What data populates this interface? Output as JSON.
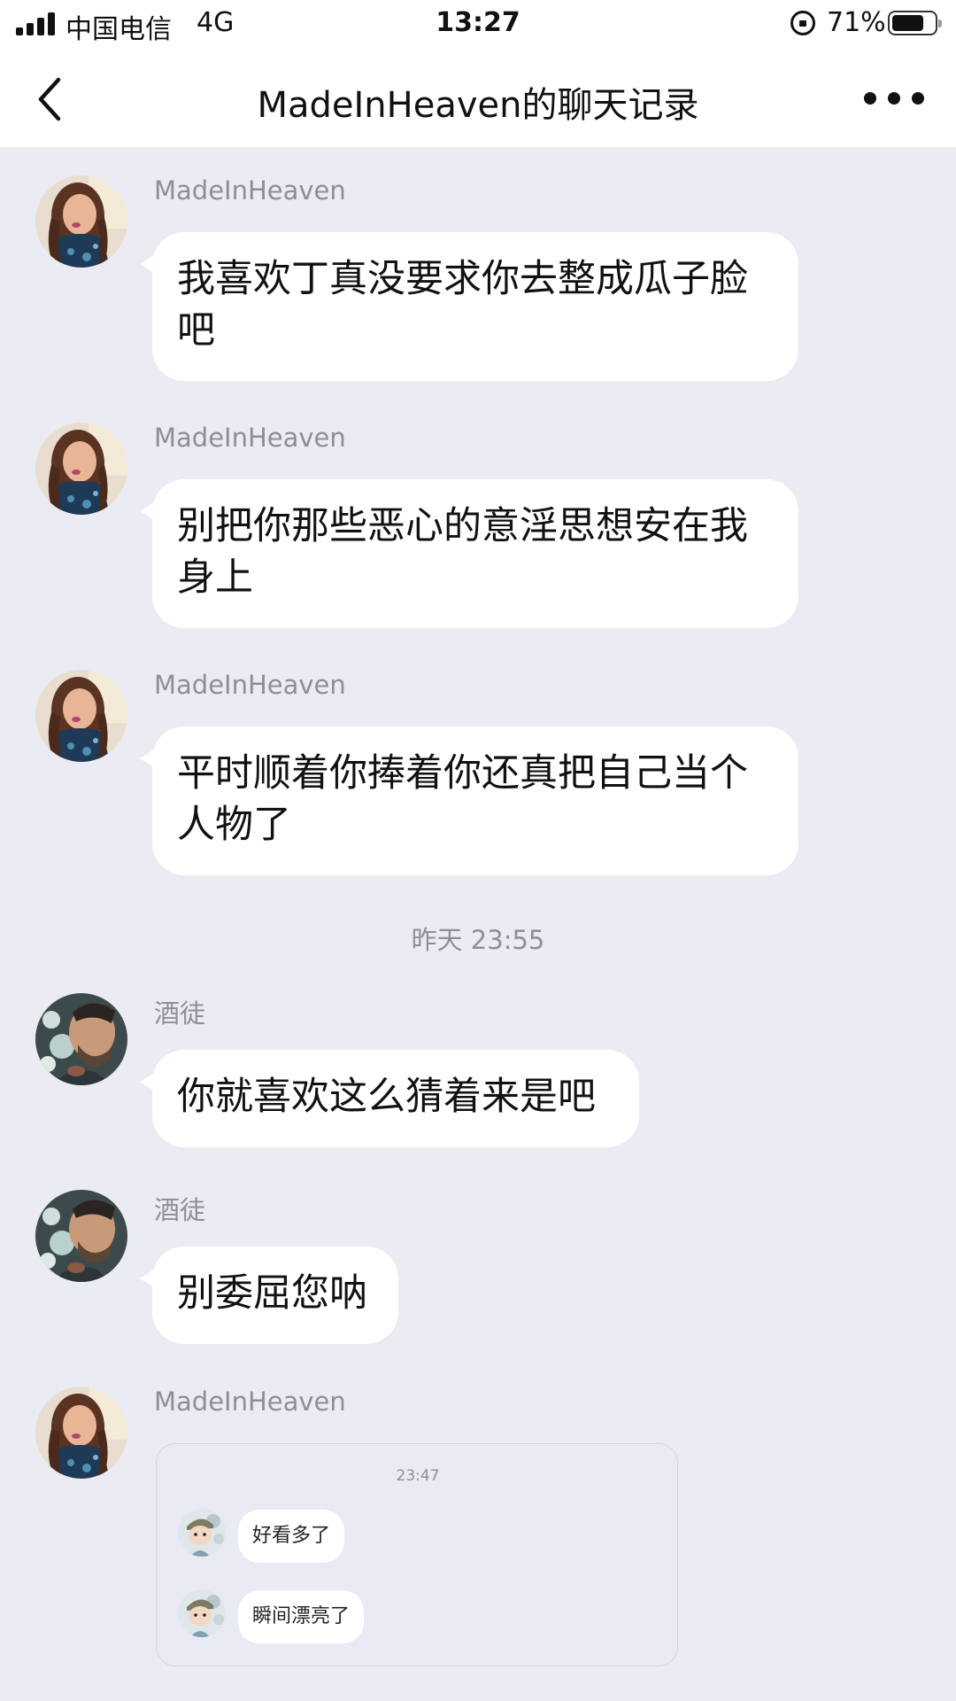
{
  "status": {
    "carrier": "中国电信",
    "network": "4G",
    "time": "13:27",
    "battery": "71%"
  },
  "nav": {
    "title": "MadeInHeaven的聊天记录"
  },
  "messages": [
    {
      "sender": "MadeInHeaven",
      "text": "我喜欢丁真没要求你去整成瓜子脸吧"
    },
    {
      "sender": "MadeInHeaven",
      "text": "别把你那些恶心的意淫思想安在我身上"
    },
    {
      "sender": "MadeInHeaven",
      "text": "平时顺着你捧着你还真把自己当个人物了"
    },
    {
      "sender": "酒徒",
      "text": "你就喜欢这么猜着来是吧"
    },
    {
      "sender": "酒徒",
      "text": "别委屈您呐"
    },
    {
      "sender": "MadeInHeaven"
    }
  ],
  "timestamp": "昨天 23:55",
  "embedded": {
    "time": "23:47",
    "lines": [
      "好看多了",
      "瞬间漂亮了"
    ]
  }
}
